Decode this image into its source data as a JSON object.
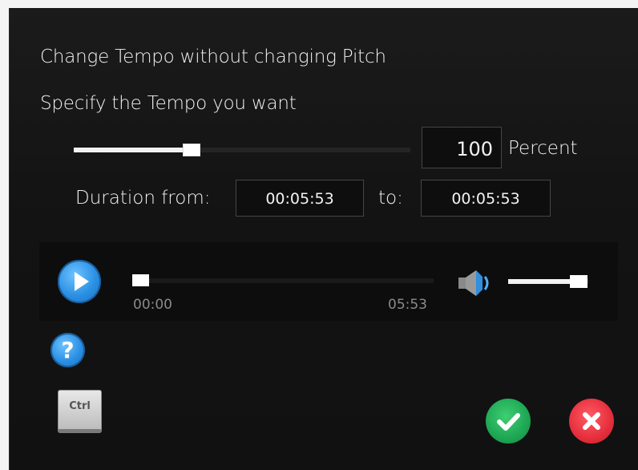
{
  "dialog": {
    "title": "Change Tempo without changing Pitch",
    "subtitle": "Specify the Tempo you want"
  },
  "tempo": {
    "slider_fraction": 0.35,
    "value": "100",
    "unit_label": "Percent"
  },
  "duration": {
    "from_label": "Duration from:",
    "from_value": "00:05:53",
    "to_label": "to:",
    "to_value": "00:05:53"
  },
  "player": {
    "start_time": "00:00",
    "end_time": "05:53",
    "position_fraction": 0.0,
    "volume_fraction": 0.88
  },
  "icons": {
    "play": "play-icon",
    "speaker": "speaker-icon",
    "help": "help-icon",
    "ctrl": "ctrl-key-icon",
    "ok": "checkmark-icon",
    "cancel": "close-icon"
  },
  "labels": {
    "help_glyph": "?",
    "ctrl_key": "Ctrl"
  },
  "colors": {
    "accent_blue": "#2a8fe3",
    "ok_green": "#1ea653",
    "cancel_red": "#e52e3b",
    "background": "#161616"
  }
}
